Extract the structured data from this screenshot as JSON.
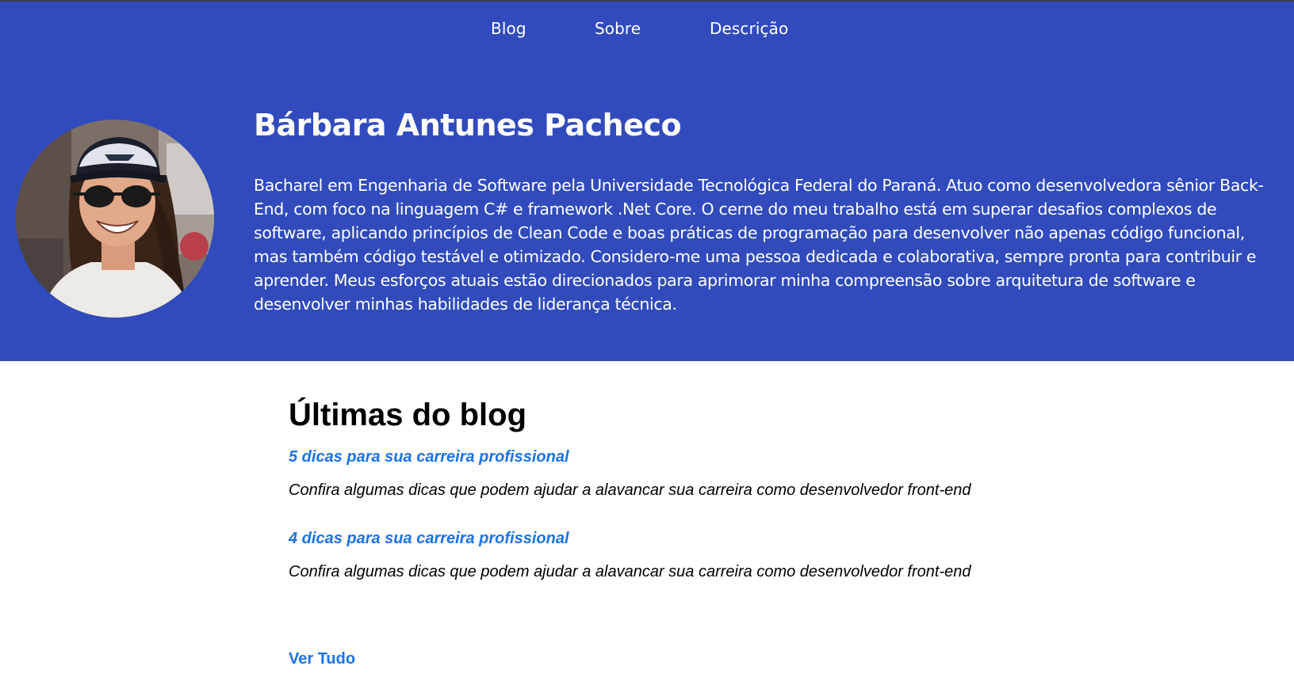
{
  "colors": {
    "hero_background": "#314bbd",
    "link": "#1a73e8",
    "text_on_hero": "#ffffff",
    "text_dark": "#000000"
  },
  "nav": {
    "items": [
      {
        "label": "Blog"
      },
      {
        "label": "Sobre"
      },
      {
        "label": "Descrição"
      }
    ]
  },
  "profile": {
    "avatar_icon": "profile-photo",
    "name": "Bárbara Antunes Pacheco",
    "bio": "Bacharel em Engenharia de Software pela Universidade Tecnológica Federal do Paraná. Atuo como desenvolvedora sênior Back-End, com foco na linguagem C# e framework .Net Core. O cerne do meu trabalho está em superar desafios complexos de software, aplicando princípios de Clean Code e boas práticas de programação para desenvolver não apenas código funcional, mas também código testável e otimizado. Considero-me uma pessoa dedicada e colaborativa, sempre pronta para contribuir e aprender. Meus esforços atuais estão direcionados para aprimorar minha compreensão sobre arquitetura de software e desenvolver minhas habilidades de liderança técnica."
  },
  "blog": {
    "title": "Últimas do blog",
    "posts": [
      {
        "title": "5 dicas para sua carreira profissional",
        "description": "Confira algumas dicas que podem ajudar a alavancar sua carreira como desenvolvedor front-end"
      },
      {
        "title": "4 dicas para sua carreira profissional",
        "description": "Confira algumas dicas que podem ajudar a alavancar sua carreira como desenvolvedor front-end"
      }
    ],
    "see_all_label": "Ver Tudo"
  }
}
